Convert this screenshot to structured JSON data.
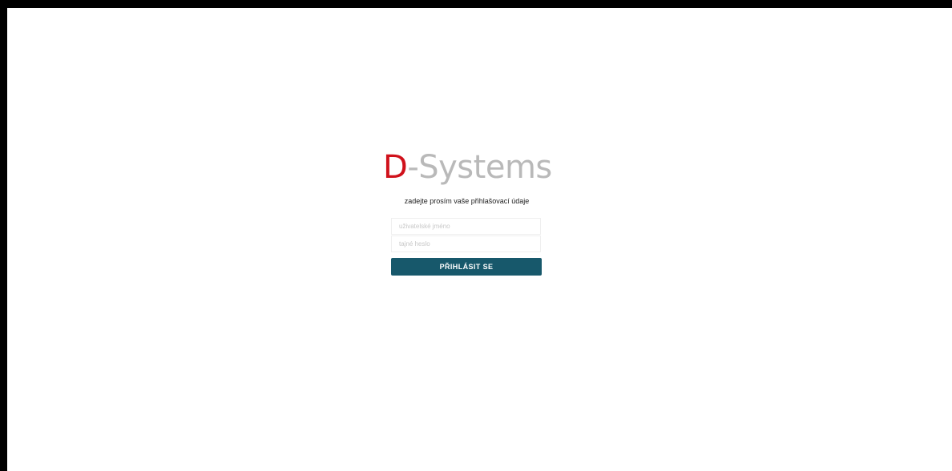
{
  "logo": {
    "letter": "D",
    "rest": "-Systems"
  },
  "login": {
    "prompt": "zadejte prosím vaše přihlašovací údaje",
    "username_placeholder": "uživatelské jméno",
    "password_placeholder": "tajné heslo",
    "username_value": "",
    "password_value": "",
    "submit_label": "PŘIHLÁSIT SE"
  },
  "colors": {
    "brand_red": "#d0111b",
    "logo_gray": "#b9b9b9",
    "button_bg": "#17586b",
    "button_text": "#ffffff"
  }
}
